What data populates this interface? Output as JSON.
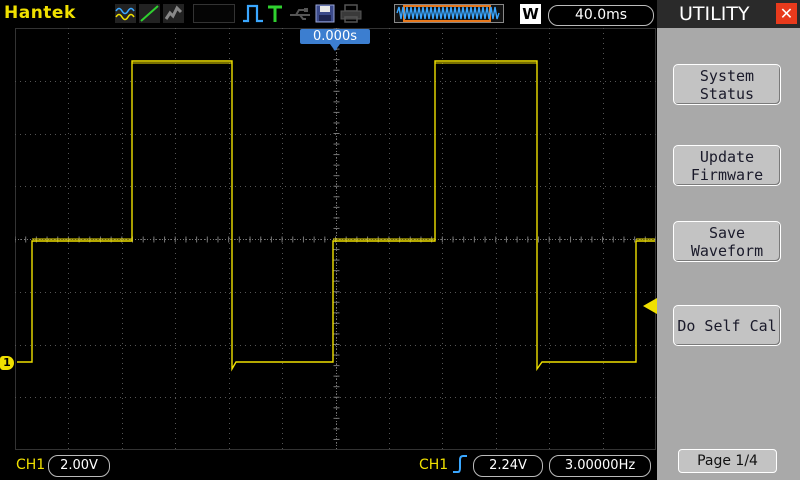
{
  "brand": "Hantek",
  "topbar": {
    "icons": [
      "waveform-mode-icon",
      "vector-icon",
      "dots-mode-icon",
      "run-stop-icon",
      "trigger-pulse-icon",
      "trigger-t-icon",
      "usb-icon",
      "save-disk-icon",
      "print-icon",
      "memory-depth-icon",
      "window-w-icon"
    ],
    "window_label": "W",
    "timebase": "40.0ms"
  },
  "trigger_position": "0.000s",
  "panel": {
    "title": "UTILITY",
    "buttons": [
      {
        "line1": "System",
        "line2": "Status"
      },
      {
        "line1": "Update",
        "line2": "Firmware"
      },
      {
        "line1": "Save",
        "line2": "Waveform"
      },
      {
        "line1": "Do Self Cal",
        "line2": ""
      }
    ],
    "page": "Page 1/4"
  },
  "channel_marker": "1",
  "bottom": {
    "ch1_label": "CH1",
    "ch1_scale": "2.00V",
    "trig_label": "CH1",
    "trig_level": "2.24V",
    "frequency": "3.00000Hz"
  },
  "colors": {
    "trace": "#f0e000",
    "accent": "#3c7ed0",
    "panel": "#a9a9a9",
    "close": "#e83a1c"
  }
}
